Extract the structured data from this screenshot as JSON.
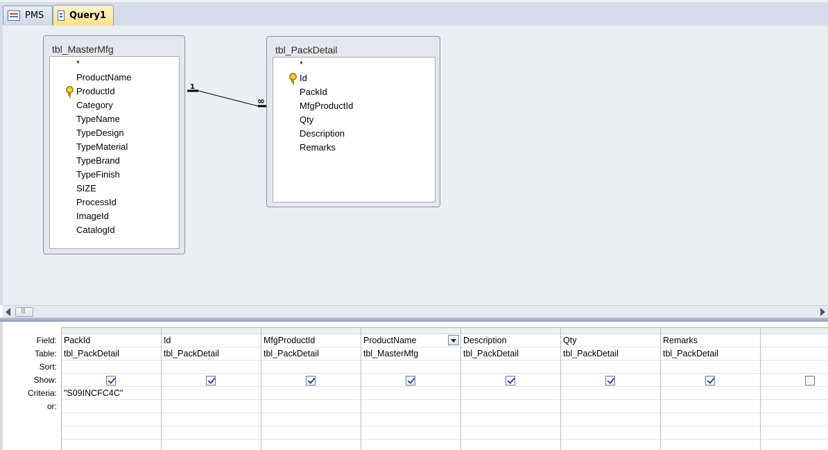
{
  "tabs": [
    {
      "label": "PMS",
      "active": false
    },
    {
      "label": "Query1",
      "active": true
    }
  ],
  "tables": {
    "master": {
      "title": "tbl_MasterMfg",
      "fields": [
        "*",
        "ProductName",
        "ProductId",
        "Category",
        "TypeName",
        "TypeDesign",
        "TypeMaterial",
        "TypeBrand",
        "TypeFinish",
        "SIZE",
        "ProcessId",
        "ImageId",
        "CatalogId"
      ],
      "key_field": "ProductId"
    },
    "detail": {
      "title": "tbl_PackDetail",
      "fields": [
        "*",
        "Id",
        "PackId",
        "MfgProductId",
        "Qty",
        "Description",
        "Remarks"
      ],
      "key_field": "Id"
    }
  },
  "relationship": {
    "one_label": "1",
    "many_label": "∞"
  },
  "qbe": {
    "row_labels": {
      "field": "Field:",
      "table": "Table:",
      "sort": "Sort:",
      "show": "Show:",
      "criteria": "Criteria:",
      "or": "or:"
    },
    "columns": [
      {
        "field": "PackId",
        "table": "tbl_PackDetail",
        "show": true,
        "criteria": "\"S09INCFC4C\""
      },
      {
        "field": "Id",
        "table": "tbl_PackDetail",
        "show": true,
        "criteria": ""
      },
      {
        "field": "MfgProductId",
        "table": "tbl_PackDetail",
        "show": true,
        "criteria": ""
      },
      {
        "field": "ProductName",
        "table": "tbl_MasterMfg",
        "show": true,
        "criteria": "",
        "selected": true
      },
      {
        "field": "Description",
        "table": "tbl_PackDetail",
        "show": true,
        "criteria": ""
      },
      {
        "field": "Qty",
        "table": "tbl_PackDetail",
        "show": true,
        "criteria": ""
      },
      {
        "field": "Remarks",
        "table": "tbl_PackDetail",
        "show": true,
        "criteria": ""
      },
      {
        "field": "",
        "table": "",
        "show": false,
        "criteria": ""
      }
    ]
  },
  "icons": {
    "tab_pms": "table-form-icon",
    "tab_query": "query-icon",
    "primary_key": "key-icon",
    "scroll_left": "arrow-left-icon",
    "scroll_right": "arrow-right-icon",
    "dropdown": "chevron-down-icon"
  },
  "colors": {
    "active_tab": "#fde08e",
    "design_surface": "#ebeef2",
    "key_icon": "#f3d34b"
  }
}
